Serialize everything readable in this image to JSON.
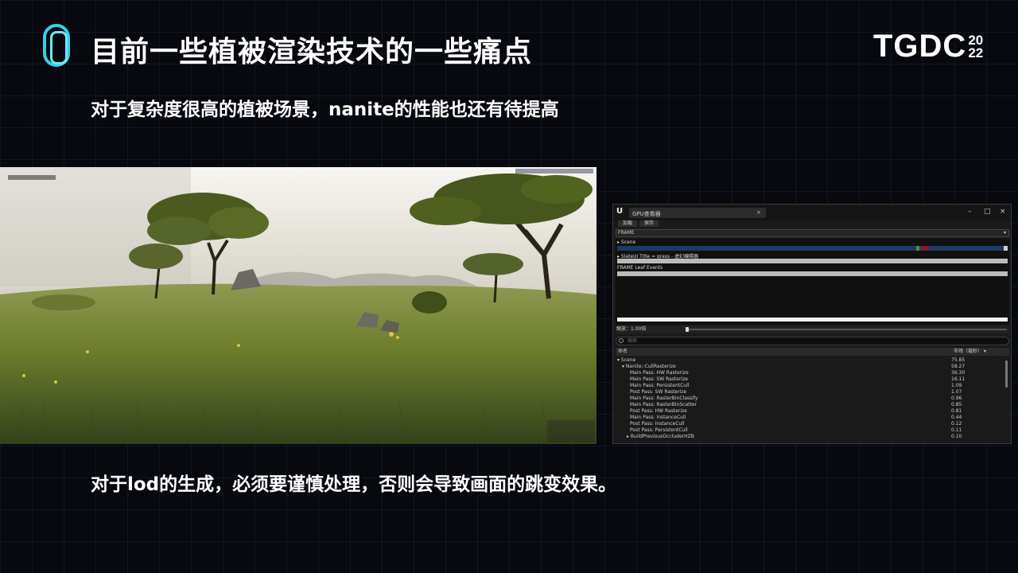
{
  "header": {
    "title": "目前一些植被渲染技术的一些痛点",
    "brand": "TGDC",
    "year_top": "20",
    "year_bottom": "22"
  },
  "subtitle": "对于复杂度很高的植被场景，nanite的性能也还有待提高",
  "bottom_text": "对于lod的生成，必须要谨慎处理，否则会导致画面的跳变效果。",
  "colors": {
    "background": "#07090f",
    "logo_accent": "#37d0e6",
    "timeline_bar": "#1c3a66"
  },
  "profiler": {
    "tab_title": "GPU查看器",
    "tab_close": "×",
    "window_buttons": [
      "–",
      "□",
      "×"
    ],
    "toolbar": [
      "加载",
      "保存"
    ],
    "frame_select": "FRAME",
    "timeline": {
      "scene": "Scene",
      "slate": "SlateUI Title = grass - 虚幻编辑器",
      "frame_leaf": "FRAME Leaf Events"
    },
    "zoom_label": "缩放：1.00倍",
    "search_placeholder": "搜索",
    "columns": {
      "name": "命名",
      "duration": "市场（毫秒）"
    },
    "rows": [
      {
        "name": "Scene",
        "value": "75.85"
      },
      {
        "name": "Nanite::CullRasterize",
        "value": "58.27"
      },
      {
        "name": "Main Pass: HW Rasterize",
        "value": "36.30"
      },
      {
        "name": "Main Pass: SW Rasterize",
        "value": "16.11"
      },
      {
        "name": "Main Pass: PersistentCull",
        "value": "1.09"
      },
      {
        "name": "Post Pass: SW Rasterize",
        "value": "1.07"
      },
      {
        "name": "Main Pass: RasterBinClassify",
        "value": "0.96"
      },
      {
        "name": "Main Pass: RasterBinScatter",
        "value": "0.85"
      },
      {
        "name": "Post Pass: HW Rasterize",
        "value": "0.81"
      },
      {
        "name": "Main Pass: InstanceCull",
        "value": "0.44"
      },
      {
        "name": "Post Pass: InstanceCull",
        "value": "0.12"
      },
      {
        "name": "Post Pass: PersistentCull",
        "value": "0.11"
      },
      {
        "name": "BuildPreviousOccluderHZB",
        "value": "0.10"
      }
    ]
  }
}
